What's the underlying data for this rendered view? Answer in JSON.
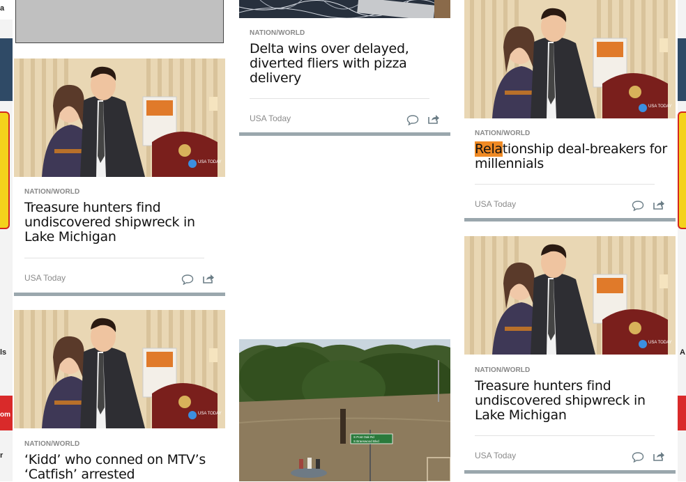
{
  "edge": {
    "left_fragments": [
      "a",
      "ls",
      "om",
      "r"
    ],
    "right_fragments": [
      "A"
    ]
  },
  "col1": {
    "cards": [
      {
        "kicker": "NATION/WORLD",
        "headline": "Treasure hunters find undiscovered shipwreck in Lake Michigan",
        "source": "USA Today",
        "image_badge": "USA TODAY"
      },
      {
        "kicker": "NATION/WORLD",
        "headline": "‘Kidd’ who conned on MTV’s ‘Catfish’ arrested",
        "image_badge": "USA TODAY"
      }
    ]
  },
  "col2": {
    "cards": [
      {
        "kicker": "NATION/WORLD",
        "headline": "Delta wins over delayed, diverted fliers with pizza delivery",
        "source": "USA Today"
      },
      {
        "image_sign_line1": "S Post Oak Rd",
        "image_sign_line2": "S Braeswood Blvd"
      }
    ]
  },
  "col3": {
    "cards": [
      {
        "kicker": "NATION/WORLD",
        "headline_highlight": "Rela",
        "headline_rest": "tionship deal-breakers for millennials",
        "source": "USA Today",
        "image_badge": "USA TODAY"
      },
      {
        "kicker": "NATION/WORLD",
        "headline": "Treasure hunters find undiscovered shipwreck in Lake Michigan",
        "source": "USA Today",
        "image_badge": "USA TODAY"
      }
    ]
  },
  "icons": [
    "comment-icon",
    "share-icon"
  ],
  "colors": {
    "highlight": "#f08a24",
    "card_bar": "#9aa7ad",
    "kicker": "#888888",
    "source": "#8a8a8a"
  }
}
